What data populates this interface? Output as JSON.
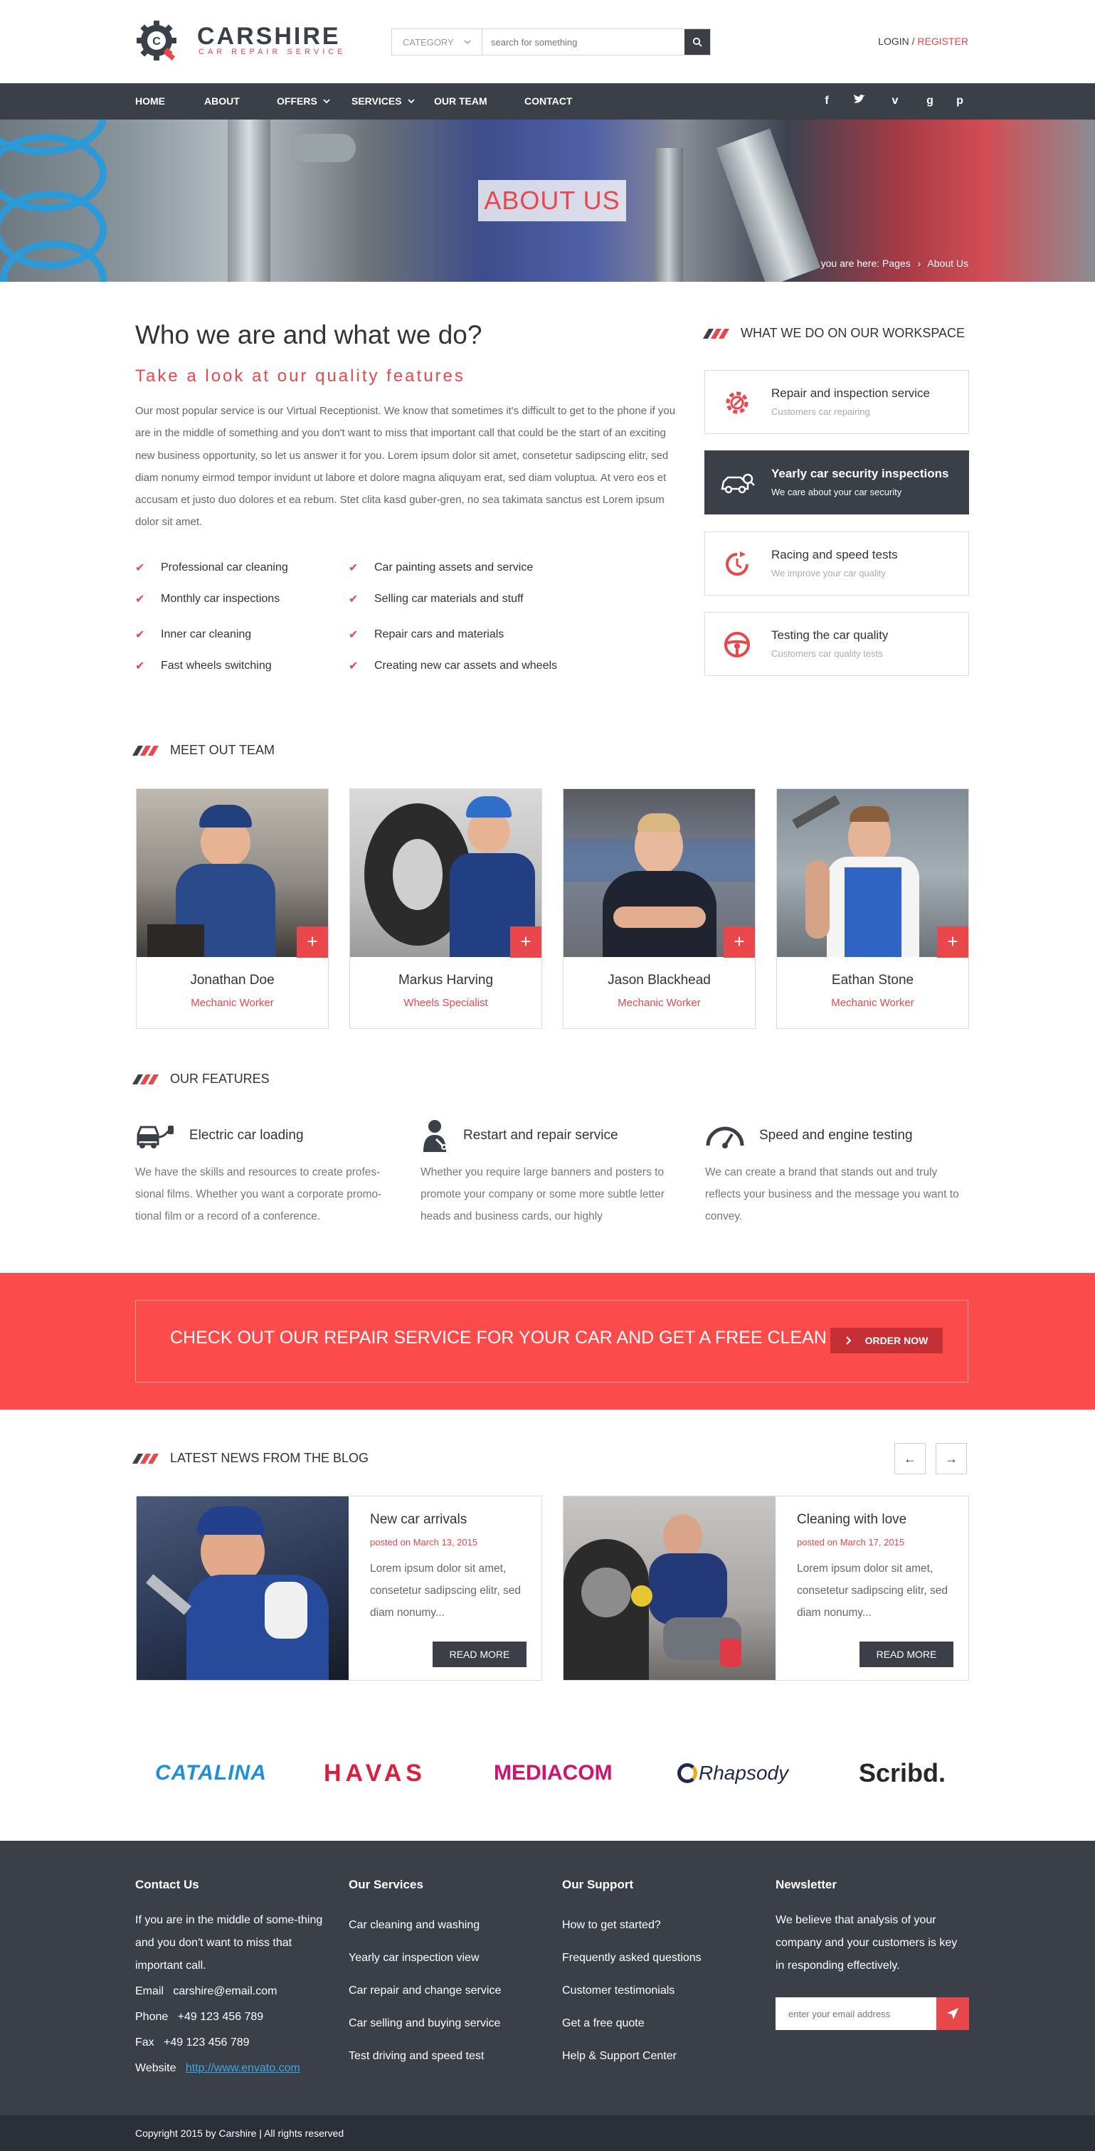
{
  "header": {
    "logo_name": "CARSHIRE",
    "logo_tagline": "CAR REPAIR SERVICE",
    "category_label": "CATEGORY",
    "search_placeholder": "search for something",
    "login": "LOGIN",
    "separator": " / ",
    "register": "REGISTER"
  },
  "nav": {
    "items": [
      {
        "label": "HOME"
      },
      {
        "label": "ABOUT"
      },
      {
        "label": "OFFERS"
      },
      {
        "label": "SERVICES"
      },
      {
        "label": "OUR TEAM"
      },
      {
        "label": "CONTACT"
      }
    ],
    "social": [
      "f",
      "t",
      "v",
      "g",
      "p"
    ]
  },
  "hero": {
    "title": "ABOUT US",
    "breadcrumb_prefix": "you are here: Pages",
    "breadcrumb_sep": "›",
    "breadcrumb_current": "About Us"
  },
  "about": {
    "heading": "Who we are and what we do?",
    "subheading": "Take a look at our quality features",
    "paragraph": "Our most popular service is our Virtual Receptionist. We know that sometimes it's difficult to get to the phone if you are in the middle of something and you don't want to miss that important call that could be the start of an exciting new business opportunity, so let us answer it for you. Lorem ipsum dolor sit amet, consetetur sadipscing elitr, sed diam nonumy eirmod tempor invidunt ut labore et dolore magna aliquyam erat, sed diam voluptua. At vero eos et accusam et justo duo dolores et ea rebum. Stet clita kasd guber-gren, no sea takimata sanctus est Lorem ipsum dolor sit amet.",
    "checklist_left": [
      "Professional car cleaning",
      "Monthly car inspections",
      "Inner car cleaning",
      "Fast wheels switching"
    ],
    "checklist_right": [
      "Car painting assets and service",
      "Selling car materials and stuff",
      "Repair cars and materials",
      "Creating new car assets and wheels"
    ]
  },
  "workspace": {
    "heading": "WHAT WE DO ON OUR WORKSPACE",
    "items": [
      {
        "title": "Repair and inspection service",
        "subtitle": "Customers car repairing",
        "icon": "gear-wrench-icon"
      },
      {
        "title": "Yearly car security inspections",
        "subtitle": "We care about your car security",
        "icon": "car-inspection-icon"
      },
      {
        "title": "Racing and speed tests",
        "subtitle": "We improve your car quality",
        "icon": "speed-clock-icon"
      },
      {
        "title": "Testing the car quality",
        "subtitle": "Customers car quality tests",
        "icon": "steering-wheel-icon"
      }
    ]
  },
  "team": {
    "heading": "MEET OUT TEAM",
    "members": [
      {
        "name": "Jonathan Doe",
        "role": "Mechanic Worker"
      },
      {
        "name": "Markus Harving",
        "role": "Wheels Specialist"
      },
      {
        "name": "Jason Blackhead",
        "role": "Mechanic Worker"
      },
      {
        "name": "Eathan Stone",
        "role": "Mechanic Worker"
      }
    ],
    "plus": "+"
  },
  "features": {
    "heading": "OUR FEATURES",
    "items": [
      {
        "title": "Electric car loading",
        "text": "We have the skills and resources to create profes-sional films. Whether you want a corporate promo-tional film or a record of a conference.",
        "icon": "electric-car-icon"
      },
      {
        "title": "Restart and repair service",
        "text": "Whether you require large banners and posters to promote your company or some more subtle letter heads and business cards, our highly",
        "icon": "mechanic-icon"
      },
      {
        "title": "Speed and engine testing",
        "text": "We can create a brand that stands out and truly reflects your business and the message you want to convey.",
        "icon": "speedometer-icon"
      }
    ]
  },
  "banner": {
    "text": "CHECK OUT OUR REPAIR SERVICE FOR YOUR CAR AND GET A FREE CLEAN",
    "button": "ORDER NOW"
  },
  "blog": {
    "heading": "LATEST NEWS FROM THE BLOG",
    "posts": [
      {
        "title": "New car arrivals",
        "date": "posted on March 13, 2015",
        "excerpt": "Lorem ipsum dolor sit amet, consetetur sadipscing elitr, sed diam nonumy...",
        "button": "READ MORE"
      },
      {
        "title": "Cleaning with love",
        "date": "posted on March 17, 2015",
        "excerpt": "Lorem ipsum dolor sit amet, consetetur sadipscing elitr, sed diam nonumy...",
        "button": "READ MORE"
      }
    ]
  },
  "brands": [
    "CATALINA",
    "HAVAS",
    "MEDIACOM",
    "Rhapsody",
    "Scribd."
  ],
  "footer": {
    "contact": {
      "heading": "Contact Us",
      "text": "If you are in the middle of some-thing and you don't want to miss that important call.",
      "email_label": "Email",
      "email": "carshire@email.com",
      "phone_label": "Phone",
      "phone": "+49 123 456 789",
      "fax_label": "Fax",
      "fax": "+49 123 456 789",
      "website_label": "Website",
      "website": "http://www.envato.com"
    },
    "services": {
      "heading": "Our Services",
      "items": [
        "Car cleaning and washing",
        "Yearly car inspection view",
        "Car repair and change service",
        "Car selling and buying service",
        "Test driving and speed test"
      ]
    },
    "support": {
      "heading": "Our Support",
      "items": [
        "How to get started?",
        "Frequently asked questions",
        "Customer testimonials",
        "Get a free quote",
        "Help & Support Center"
      ]
    },
    "newsletter": {
      "heading": "Newsletter",
      "text": "We believe that analysis of your company and your customers is key in responding effectively.",
      "placeholder": "enter your email address"
    },
    "copyright": "Copyright 2015 by Carshire | All rights reserved"
  },
  "colors": {
    "accent": "#e8474b",
    "dark": "#3a3f48",
    "banner": "#fb4b4b"
  }
}
